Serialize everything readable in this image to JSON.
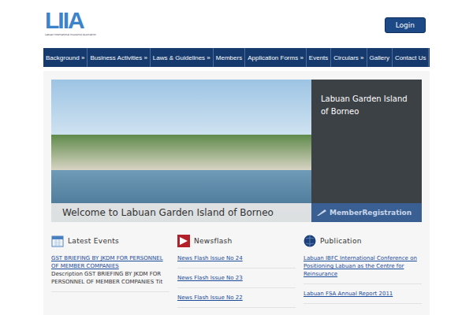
{
  "logo": {
    "mark": "LIIA",
    "subtitle": "Labuan International Insurance Association"
  },
  "login": {
    "label": "Login"
  },
  "nav": [
    {
      "label": "Background »"
    },
    {
      "label": "Business Activities »"
    },
    {
      "label": "Laws & Guidelines »"
    },
    {
      "label": "Members"
    },
    {
      "label": "Application Forms »"
    },
    {
      "label": "Events"
    },
    {
      "label": "Circulars »"
    },
    {
      "label": "Gallery"
    },
    {
      "label": "Contact Us"
    }
  ],
  "slider": {
    "side_title": "Labuan Garden Island of Borneo",
    "caption": "Welcome to Labuan Garden Island of Borneo",
    "registration": "MemberRegistration"
  },
  "sections": [
    {
      "title": "Latest Events",
      "kind": "events",
      "items": [
        {
          "link": "GST BRIEFING BY JKDM FOR PERSONNEL OF MEMBER COMPANIES",
          "description": "Description GST BRIEFING BY JKDM FOR PERSONNEL OF MEMBER COMPANIES Tit"
        }
      ]
    },
    {
      "title": "Newsflash",
      "kind": "news",
      "items": [
        {
          "link": "News Flash Issue No 24"
        },
        {
          "link": "News Flash Issue No 23"
        },
        {
          "link": "News Flash Issue No 22"
        }
      ]
    },
    {
      "title": "Publication",
      "kind": "publication",
      "items": [
        {
          "link": "Labuan IBFC International Conference on Positioning Labuan as the Centre for Reinsurance"
        },
        {
          "link": "Labuan FSA Annual Report 2011"
        }
      ]
    }
  ]
}
